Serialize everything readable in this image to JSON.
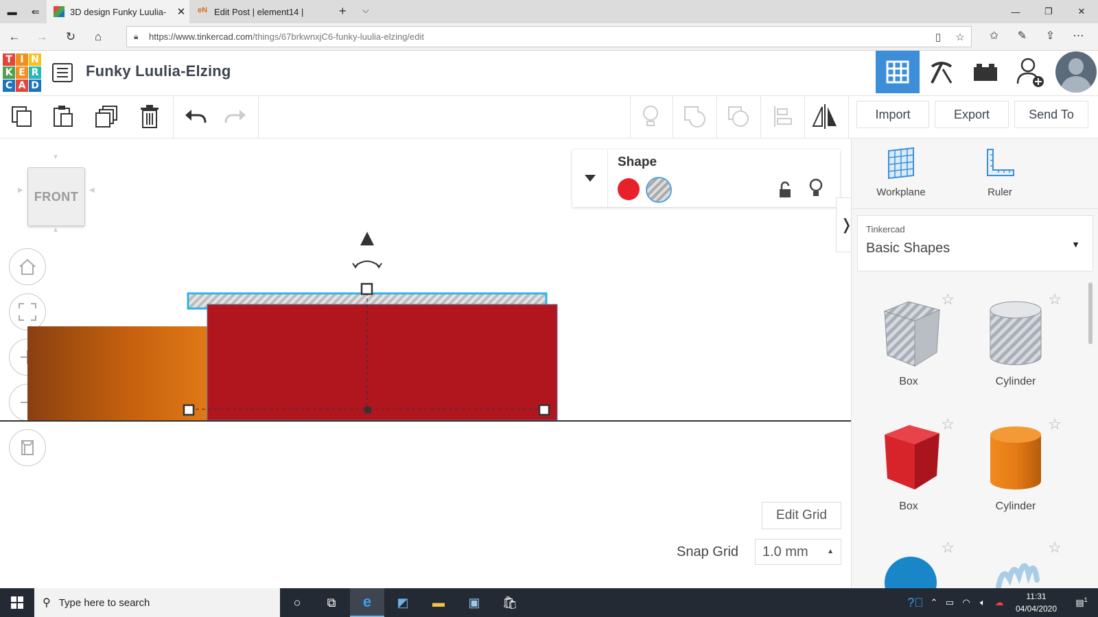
{
  "browser": {
    "tabs": [
      {
        "title": "3D design Funky Luulia-",
        "active": true
      },
      {
        "title": "Edit Post | element14 |",
        "active": false
      }
    ],
    "url": "https://www.tinkercad.com/things/67brkwnxjC6-funky-luulia-elzing/edit",
    "url_prefix": "https://www.tinkercad.com",
    "url_path": "/things/67brkwnxjC6-funky-luulia-elzing/edit"
  },
  "app": {
    "logo_letters": [
      "T",
      "I",
      "N",
      "K",
      "E",
      "R",
      "C",
      "A",
      "D"
    ],
    "design_title": "Funky Luulia-Elzing",
    "modes": [
      "3d-design",
      "build",
      "blocks"
    ],
    "active_mode": "3d-design"
  },
  "toolbar": {
    "import_label": "Import",
    "export_label": "Export",
    "sendto_label": "Send To"
  },
  "viewport": {
    "viewcube_label": "FRONT",
    "shape_panel": {
      "title": "Shape",
      "solid_color": "#e8202a",
      "hole_selected": true
    },
    "edit_grid_label": "Edit Grid",
    "snap_grid_label": "Snap Grid",
    "snap_grid_value": "1.0 mm"
  },
  "right_panel": {
    "workplane_label": "Workplane",
    "ruler_label": "Ruler",
    "library_source": "Tinkercad",
    "library_name": "Basic Shapes",
    "shapes": [
      {
        "label": "Box",
        "style": "hole"
      },
      {
        "label": "Cylinder",
        "style": "hole"
      },
      {
        "label": "Box",
        "style": "solid",
        "color": "#d7242b"
      },
      {
        "label": "Cylinder",
        "style": "solid",
        "color": "#e57b16"
      }
    ]
  },
  "taskbar": {
    "search_placeholder": "Type here to search",
    "time": "11:31",
    "date": "04/04/2020",
    "notification_count": "1"
  },
  "colors": {
    "accent_blue": "#3d8ed8",
    "shape_red": "#b1161f",
    "shape_orange": "#e57b16",
    "selection": "#2bb4e8"
  }
}
